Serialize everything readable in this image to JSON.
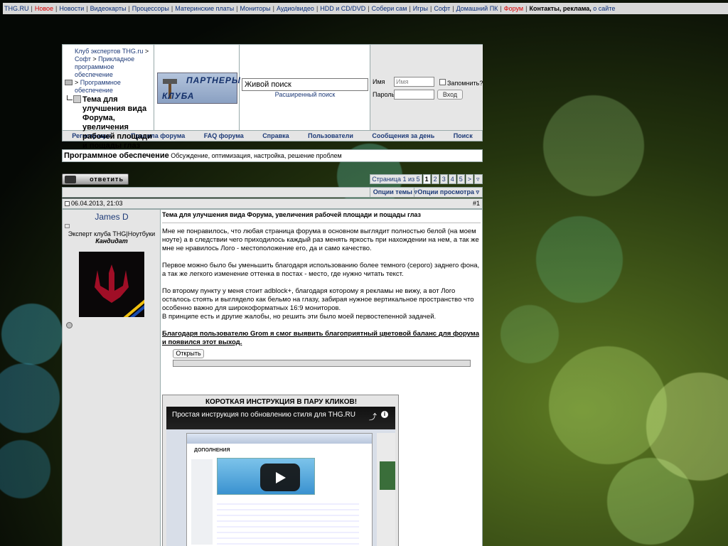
{
  "topbar": {
    "site": "THG.RU",
    "news_ticker": "Новое",
    "links": [
      "Новости",
      "Видеокарты",
      "Процессоры",
      "Материнские платы",
      "Мониторы",
      "Аудио/видео",
      "HDD и CD/DVD",
      "Собери сам",
      "Игры",
      "Софт",
      "Домашний ПК"
    ],
    "forum": "Форум",
    "contacts": "Контакты, реклама,",
    "on_site": "о сайте"
  },
  "breadcrumbs": {
    "club": "Клуб экспертов THG.ru",
    "soft": "Софт",
    "applied": "Прикладное программное обеспечение",
    "software": "Программное обеспечение",
    "current": "Тема для улучшения вида Форума, увеличения рабочей площади и пощады глаз"
  },
  "partners": {
    "line1": "ПАРТНЕРЫ",
    "line2": "КЛУБА"
  },
  "search": {
    "value": "Живой поиск",
    "advanced": "Расширенный поиск"
  },
  "login": {
    "name_label": "Имя",
    "name_placeholder": "Имя",
    "remember": "Запомнить?",
    "password_label": "Пароль",
    "submit": "Вход"
  },
  "nav": [
    "Регистрация",
    "Правила форума",
    "FAQ форума",
    "Справка",
    "Пользователи",
    "Сообщения за день",
    "Поиск"
  ],
  "forum": {
    "name": "Программное обеспечение",
    "description": "Обсуждение, оптимизация, настройка, решение проблем"
  },
  "reply_label": "ответить",
  "pager": {
    "info": "Страница 1 из 5",
    "pages": [
      "1",
      "2",
      "3",
      "4",
      "5"
    ],
    "next": ">"
  },
  "options": {
    "thread": "Опции темы",
    "view": "Опции просмотра"
  },
  "post": {
    "date": "06.04.2013, 21:03",
    "number": "#1",
    "username": "James D",
    "user_role": "Эксперт клуба THG|Ноутбуки",
    "user_rank": "Кандидат",
    "title": "Тема для улучшения вида Форума, увеличения рабочей площади и пощады глаз",
    "paragraphs": [
      "Мне не понравилось, что любая страница форума в основном выглядит полностью белой (на моем ноуте) а в следствии чего приходилось каждый раз менять яркость при нахождении на нем, а так же мне не нравилось Лого - местоположение его, да и само качество.",
      "Первое можно было бы уменьшить благодаря использованию более темного (серого) заднего фона, а так же легкого изменение оттенка в постах - место, где нужно читать текст.",
      "По второму пункту у меня стоит adblock+, благодаря которому я рекламы не вижу, а вот Лого осталось стоять и выглядело как бельмо на глазу, забирая нужное вертикальное пространство что особенно важно для широкоформатных 16:9 мониторов.",
      "В принципе есть и другие жалобы, но решить эти было моей первостепенной задачей."
    ],
    "thanks": "Благодаря пользователю Grom я смог выявить благоприятный цветовой баланс для форума и появился этот выход.",
    "spoiler_button": "Открыть"
  },
  "video": {
    "box_title": "КОРОТКАЯ ИНСТРУКЦИЯ В ПАРУ КЛИКОВ!",
    "title": "Простая инструкция по обновлению стиля для THG.RU",
    "page_header": "ДОПОЛНЕНИЯ",
    "info_label": "i"
  }
}
